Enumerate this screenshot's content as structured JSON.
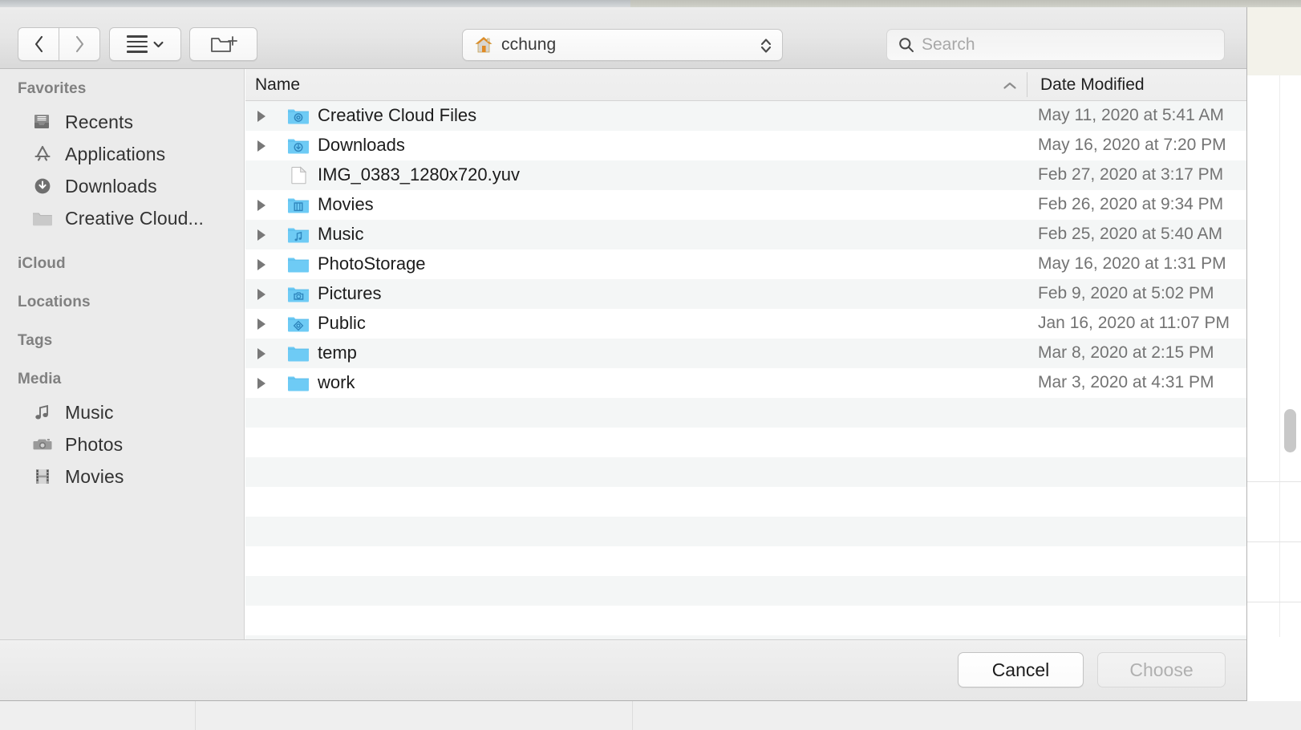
{
  "window": {
    "kind": "macos-open-file-sheet"
  },
  "toolbar": {
    "back_icon": "chevron-left-icon",
    "forward_icon": "chevron-right-icon",
    "view_mode_icon": "list-view-icon",
    "view_mode_chevron": "chevron-down-icon",
    "new_folder_icon": "new-folder-icon",
    "path": {
      "icon": "home-icon",
      "label": "cchung",
      "stepper_icon": "stepper-updown-icon"
    },
    "search": {
      "icon": "search-icon",
      "placeholder": "Search",
      "value": ""
    }
  },
  "sidebar": {
    "sections": [
      {
        "title": "Favorites",
        "items": [
          {
            "label": "Recents",
            "icon": "recents-icon"
          },
          {
            "label": "Applications",
            "icon": "applications-icon"
          },
          {
            "label": "Downloads",
            "icon": "downloads-icon"
          },
          {
            "label": "Creative Cloud...",
            "icon": "folder-icon"
          }
        ]
      },
      {
        "title": "iCloud",
        "items": []
      },
      {
        "title": "Locations",
        "items": []
      },
      {
        "title": "Tags",
        "items": []
      },
      {
        "title": "Media",
        "items": [
          {
            "label": "Music",
            "icon": "music-note-icon"
          },
          {
            "label": "Photos",
            "icon": "camera-icon"
          },
          {
            "label": "Movies",
            "icon": "film-icon"
          }
        ]
      }
    ]
  },
  "file_list": {
    "columns": [
      {
        "key": "name",
        "label": "Name",
        "sorted": true,
        "sort_direction": "ascending"
      },
      {
        "key": "date",
        "label": "Date Modified",
        "sorted": false
      }
    ],
    "rows": [
      {
        "name": "Creative Cloud Files",
        "date": "May 11, 2020 at 5:41 AM",
        "type": "folder",
        "icon": "folder-creative-cloud-icon",
        "expandable": true
      },
      {
        "name": "Downloads",
        "date": "May 16, 2020 at 7:20 PM",
        "type": "folder",
        "icon": "folder-downloads-icon",
        "expandable": true
      },
      {
        "name": "IMG_0383_1280x720.yuv",
        "date": "Feb 27, 2020 at 3:17 PM",
        "type": "file",
        "icon": "document-icon",
        "expandable": false
      },
      {
        "name": "Movies",
        "date": "Feb 26, 2020 at 9:34 PM",
        "type": "folder",
        "icon": "folder-movies-icon",
        "expandable": true
      },
      {
        "name": "Music",
        "date": "Feb 25, 2020 at 5:40 AM",
        "type": "folder",
        "icon": "folder-music-icon",
        "expandable": true
      },
      {
        "name": "PhotoStorage",
        "date": "May 16, 2020 at 1:31 PM",
        "type": "folder",
        "icon": "folder-icon",
        "expandable": true
      },
      {
        "name": "Pictures",
        "date": "Feb 9, 2020 at 5:02 PM",
        "type": "folder",
        "icon": "folder-pictures-icon",
        "expandable": true
      },
      {
        "name": "Public",
        "date": "Jan 16, 2020 at 11:07 PM",
        "type": "folder",
        "icon": "folder-public-icon",
        "expandable": true
      },
      {
        "name": "temp",
        "date": "Mar 8, 2020 at 2:15 PM",
        "type": "folder",
        "icon": "folder-icon",
        "expandable": true
      },
      {
        "name": "work",
        "date": "Mar 3, 2020 at 4:31 PM",
        "type": "folder",
        "icon": "folder-icon",
        "expandable": true
      }
    ]
  },
  "footer": {
    "cancel_label": "Cancel",
    "choose_label": "Choose",
    "choose_enabled": false
  },
  "colors": {
    "folder_blue": "#6ECBF5",
    "folder_glyph": "#3C9FD6",
    "toolbar_bg": "#E6E6E6",
    "sidebar_bg": "#EBEBEB",
    "row_stripe": "#F4F6F6",
    "text_primary": "#1C1C1C",
    "text_secondary": "#737373",
    "home_orange": "#E08A24"
  }
}
